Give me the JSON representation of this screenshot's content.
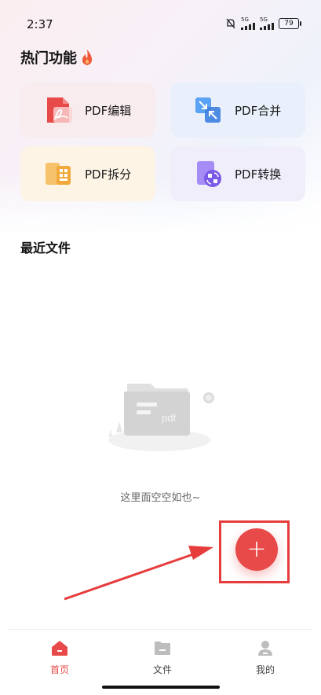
{
  "status_bar": {
    "time": "2:37",
    "signal1": "5G",
    "signal2": "5G",
    "battery": "79"
  },
  "hot_section": {
    "title": "热门功能",
    "flame_icon": "flame-icon"
  },
  "tools": [
    {
      "label": "PDF编辑",
      "icon": "pdf-edit-icon",
      "color": "#e84a4a"
    },
    {
      "label": "PDF合并",
      "icon": "pdf-merge-icon",
      "color": "#3d8df0"
    },
    {
      "label": "PDF拆分",
      "icon": "pdf-split-icon",
      "color": "#f0a93a"
    },
    {
      "label": "PDF转换",
      "icon": "pdf-convert-icon",
      "color": "#8b6cf0"
    }
  ],
  "recent": {
    "title": "最近文件",
    "empty_text": "这里面空空如也~"
  },
  "fab": {
    "label": "+",
    "color": "#e84a4a"
  },
  "nav": [
    {
      "label": "首页",
      "icon": "home-icon",
      "active": true
    },
    {
      "label": "文件",
      "icon": "folder-icon",
      "active": false
    },
    {
      "label": "我的",
      "icon": "user-icon",
      "active": false
    }
  ],
  "colors": {
    "accent": "#e84a4a",
    "annotation": "#e63c3c"
  }
}
